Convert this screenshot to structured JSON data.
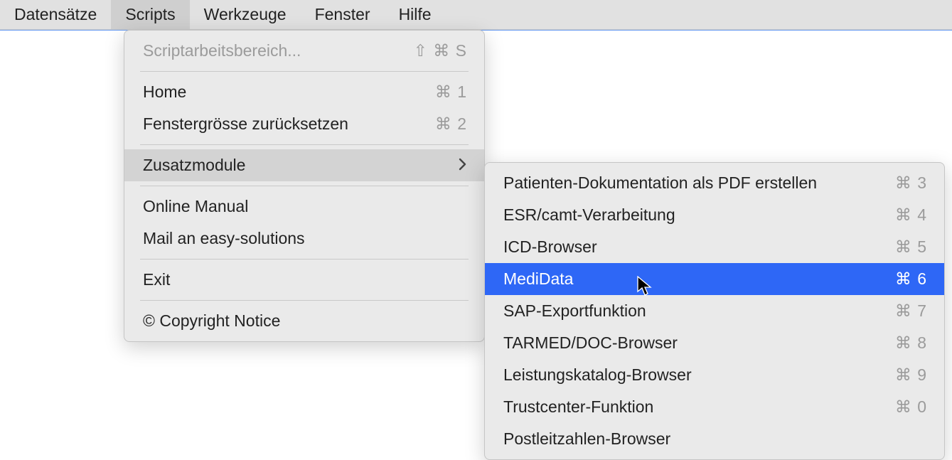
{
  "menubar": {
    "items": [
      {
        "label": "Datensätze"
      },
      {
        "label": "Scripts"
      },
      {
        "label": "Werkzeuge"
      },
      {
        "label": "Fenster"
      },
      {
        "label": "Hilfe"
      }
    ]
  },
  "dropdown_main": {
    "items": [
      {
        "label": "Scriptarbeitsbereich...",
        "shortcut": "⇧ ⌘ S",
        "disabled": true
      },
      {
        "label": "Home",
        "shortcut": "⌘ 1"
      },
      {
        "label": "Fenstergrösse zurücksetzen",
        "shortcut": "⌘ 2"
      },
      {
        "label": "Zusatzmodule",
        "submenu": true,
        "hover": true
      },
      {
        "label": "Online Manual"
      },
      {
        "label": "Mail an easy-solutions"
      },
      {
        "label": "Exit"
      },
      {
        "label": "© Copyright Notice"
      }
    ]
  },
  "dropdown_sub": {
    "items": [
      {
        "label": "Patienten-Dokumentation als PDF erstellen",
        "shortcut": "⌘ 3"
      },
      {
        "label": "ESR/camt-Verarbeitung",
        "shortcut": "⌘ 4"
      },
      {
        "label": "ICD-Browser",
        "shortcut": "⌘ 5"
      },
      {
        "label": "MediData",
        "shortcut": "⌘ 6",
        "selected": true
      },
      {
        "label": "SAP-Exportfunktion",
        "shortcut": "⌘ 7"
      },
      {
        "label": "TARMED/DOC-Browser",
        "shortcut": "⌘ 8"
      },
      {
        "label": "Leistungskatalog-Browser",
        "shortcut": "⌘ 9"
      },
      {
        "label": "Trustcenter-Funktion",
        "shortcut": "⌘ 0"
      },
      {
        "label": "Postleitzahlen-Browser"
      }
    ]
  }
}
